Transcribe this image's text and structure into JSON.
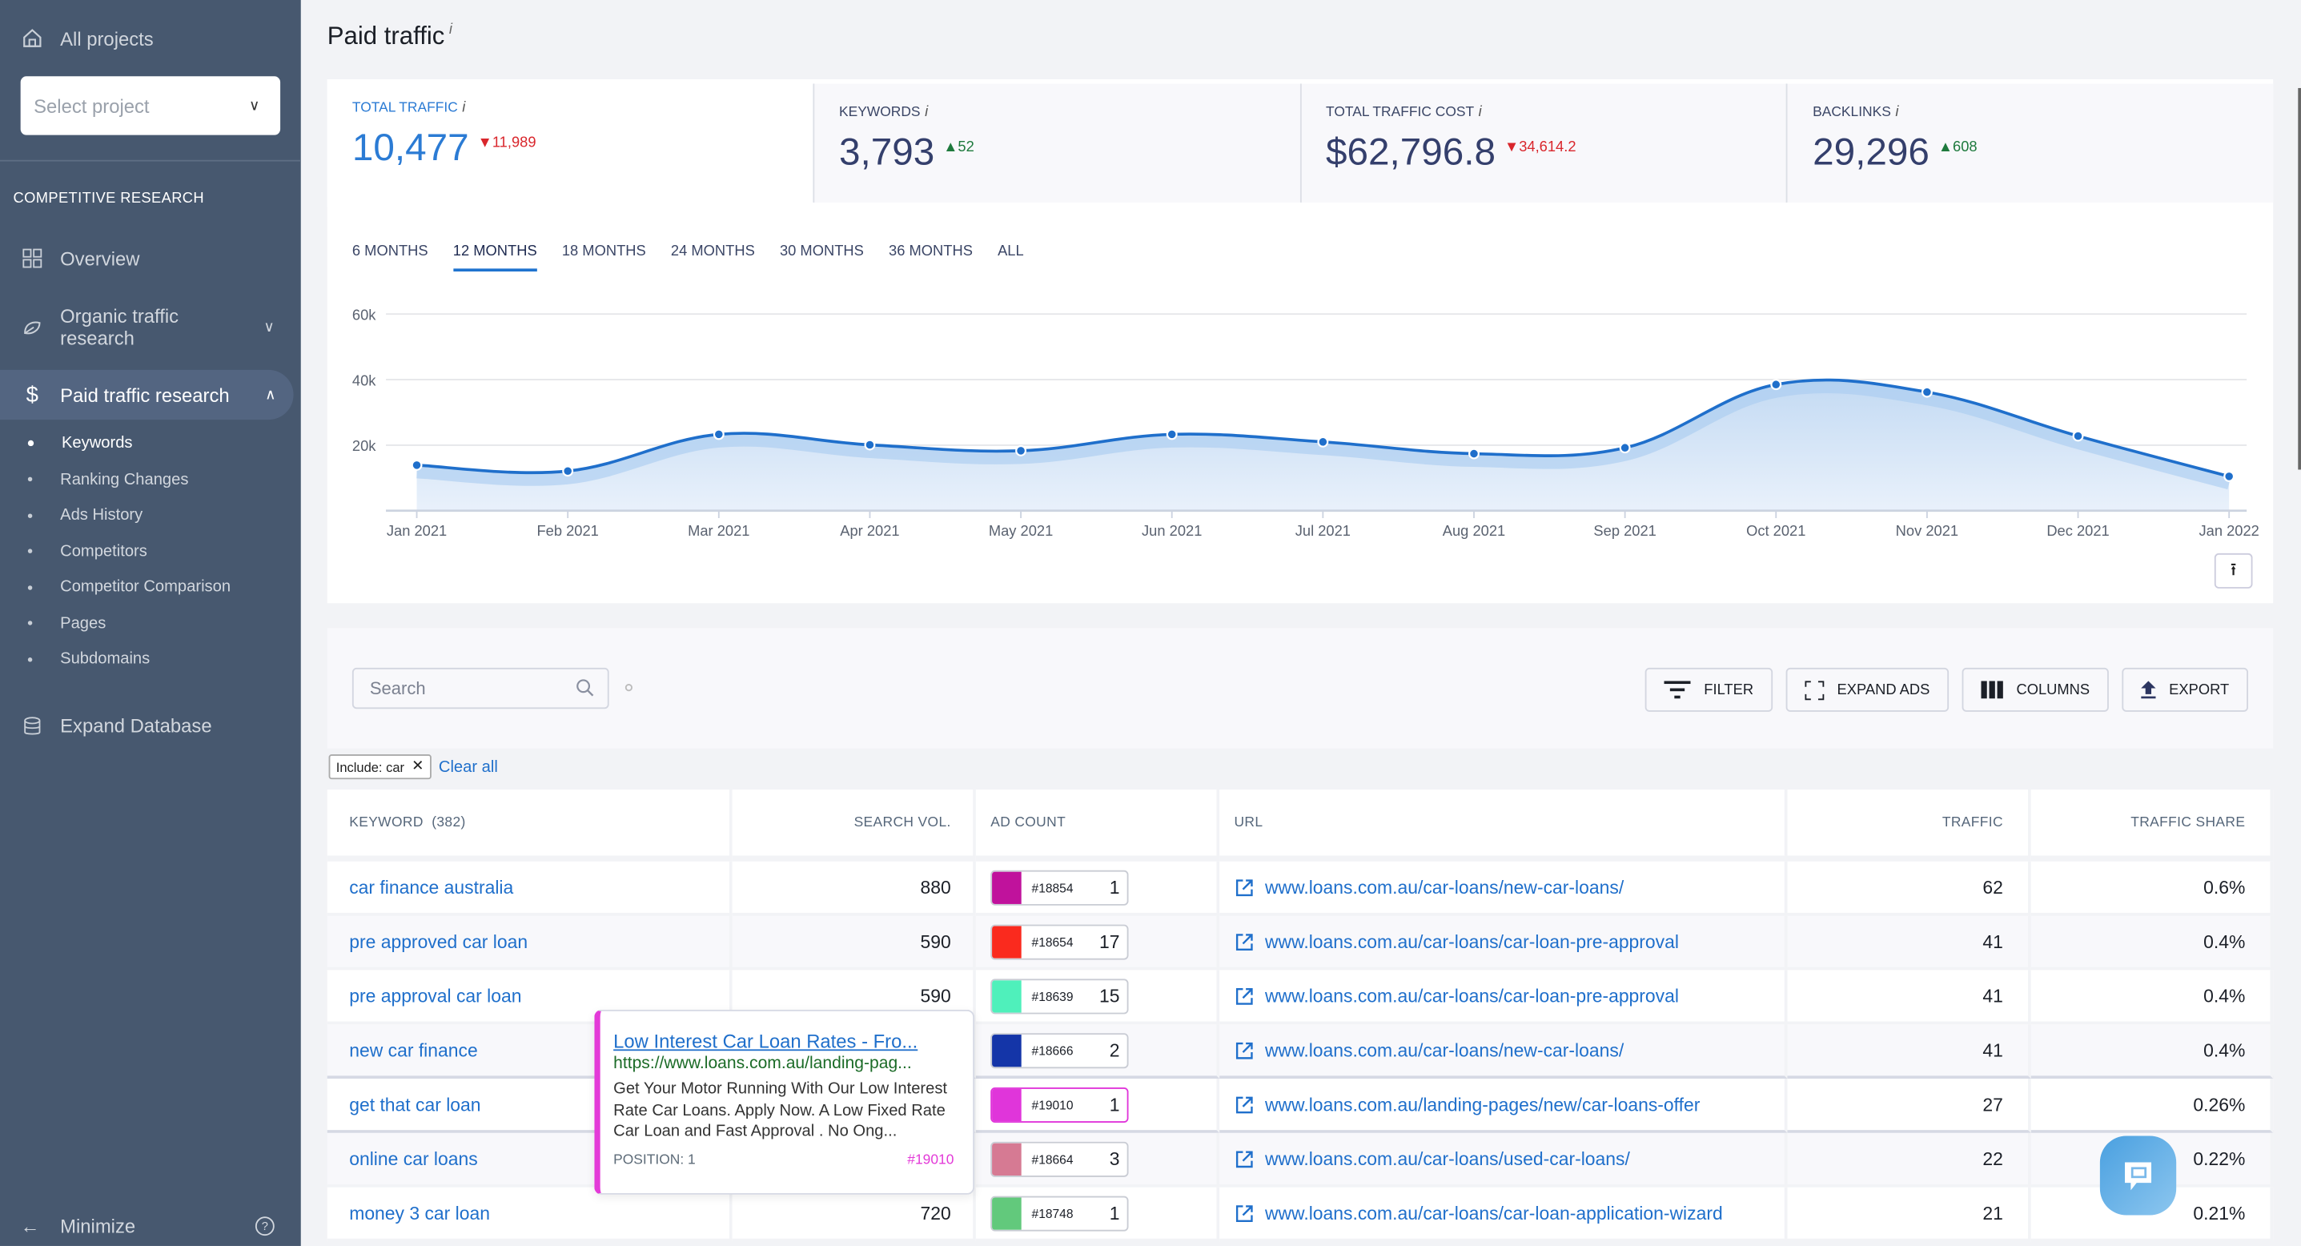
{
  "sidebar": {
    "all_projects": "All projects",
    "project_select_placeholder": "Select project",
    "section_title": "COMPETITIVE RESEARCH",
    "items": [
      {
        "label": "Overview",
        "icon": "grid-icon"
      },
      {
        "label": "Organic traffic research",
        "icon": "leaf-icon"
      },
      {
        "label": "Paid traffic research",
        "icon": "dollar-icon"
      }
    ],
    "sub_items": [
      "Keywords",
      "Ranking Changes",
      "Ads History",
      "Competitors",
      "Competitor Comparison",
      "Pages",
      "Subdomains"
    ],
    "expand_db": "Expand Database",
    "minimize": "Minimize"
  },
  "page": {
    "title": "Paid traffic",
    "info": "i"
  },
  "kpis": [
    {
      "label": "TOTAL TRAFFIC",
      "value": "10,477",
      "delta": "11,989",
      "direction": "down"
    },
    {
      "label": "KEYWORDS",
      "value": "3,793",
      "delta": "52",
      "direction": "up"
    },
    {
      "label": "TOTAL TRAFFIC COST",
      "value": "$62,796.8",
      "delta": "34,614.2",
      "direction": "down"
    },
    {
      "label": "BACKLINKS",
      "value": "29,296",
      "delta": "608",
      "direction": "up"
    }
  ],
  "range_tabs": [
    "6 MONTHS",
    "12 MONTHS",
    "18 MONTHS",
    "24 MONTHS",
    "30 MONTHS",
    "36 MONTHS",
    "ALL"
  ],
  "active_tab": "12 MONTHS",
  "chart_data": {
    "type": "area",
    "title": "",
    "xlabel": "",
    "ylabel": "",
    "categories": [
      "Jan 2021",
      "Feb 2021",
      "Mar 2021",
      "Apr 2021",
      "May 2021",
      "Jun 2021",
      "Jul 2021",
      "Aug 2021",
      "Sep 2021",
      "Oct 2021",
      "Nov 2021",
      "Dec 2021",
      "Jan 2022"
    ],
    "series": [
      {
        "name": "Paid traffic",
        "values": [
          13900,
          12100,
          23300,
          20100,
          18300,
          23300,
          21000,
          17400,
          19200,
          38500,
          36200,
          22800,
          10477
        ]
      }
    ],
    "ylim": [
      0,
      60000
    ],
    "yticks": [
      {
        "v": 20000,
        "label": "20k"
      },
      {
        "v": 40000,
        "label": "40k"
      },
      {
        "v": 60000,
        "label": "60k"
      }
    ],
    "grid": true,
    "color": "#1f6fcb"
  },
  "toolbar": {
    "search_placeholder": "Search",
    "filter": "FILTER",
    "expand_ads": "EXPAND ADS",
    "columns": "COLUMNS",
    "export": "EXPORT"
  },
  "filters": {
    "chip": "Include: car",
    "clear_all": "Clear all"
  },
  "table": {
    "headers": {
      "keyword": "KEYWORD",
      "keyword_count": "(382)",
      "search_vol": "SEARCH VOL.",
      "ad_count": "AD COUNT",
      "url": "URL",
      "traffic": "TRAFFIC",
      "traffic_share": "TRAFFIC SHARE"
    },
    "rows": [
      {
        "keyword": "car finance australia",
        "search_vol": "880",
        "ad_id": "#18854",
        "ad_color": "#c0129c",
        "ad_count": "1",
        "url": "www.loans.com.au/car-loans/new-car-loans/",
        "traffic": "62",
        "share": "0.6%"
      },
      {
        "keyword": "pre approved car loan",
        "search_vol": "590",
        "ad_id": "#18654",
        "ad_color": "#fa2a1e",
        "ad_count": "17",
        "url": "www.loans.com.au/car-loans/car-loan-pre-approval",
        "traffic": "41",
        "share": "0.4%"
      },
      {
        "keyword": "pre approval car loan",
        "search_vol": "590",
        "ad_id": "#18639",
        "ad_color": "#4ff0bb",
        "ad_count": "15",
        "url": "www.loans.com.au/car-loans/car-loan-pre-approval",
        "traffic": "41",
        "share": "0.4%"
      },
      {
        "keyword": "new car finance",
        "search_vol": "",
        "ad_id": "#18666",
        "ad_color": "#1435a8",
        "ad_count": "2",
        "url": "www.loans.com.au/car-loans/new-car-loans/",
        "traffic": "41",
        "share": "0.4%"
      },
      {
        "keyword": "get that car loan",
        "search_vol": "",
        "ad_id": "#19010",
        "ad_color": "#e035da",
        "ad_count": "1",
        "url": "www.loans.com.au/landing-pages/new/car-loans-offer",
        "traffic": "27",
        "share": "0.26%"
      },
      {
        "keyword": "online car loans",
        "search_vol": "",
        "ad_id": "#18664",
        "ad_color": "#d67a93",
        "ad_count": "3",
        "url": "www.loans.com.au/car-loans/used-car-loans/",
        "traffic": "22",
        "share": "0.22%"
      },
      {
        "keyword": "money 3 car loan",
        "search_vol": "720",
        "ad_id": "#18748",
        "ad_color": "#62c97c",
        "ad_count": "1",
        "url": "www.loans.com.au/car-loans/car-loan-application-wizard",
        "traffic": "21",
        "share": "0.21%"
      }
    ]
  },
  "tooltip": {
    "title": "Low Interest Car Loan Rates - Fro...",
    "url": "https://www.loans.com.au/landing-pag...",
    "description": "Get Your Motor Running With Our Low Interest Rate Car Loans. Apply Now. A Low Fixed Rate Car Loan and Fast Approval . No Ong...",
    "position": "POSITION: 1",
    "ad_id": "#19010",
    "accent": "#e33ad8"
  }
}
